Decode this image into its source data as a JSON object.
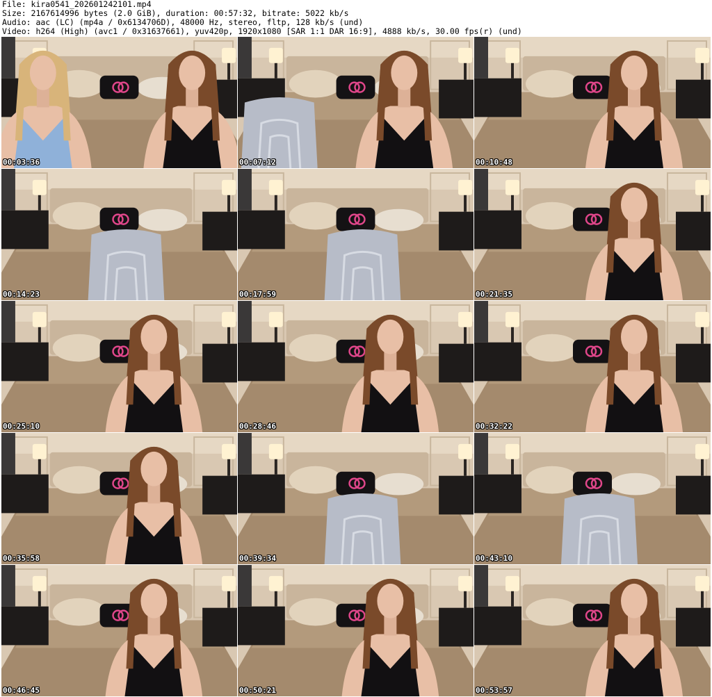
{
  "header": {
    "file_line": "File: kira0541_202601242101.mp4",
    "size_line": "Size: 2167614996 bytes (2.0 GiB), duration: 00:57:32, bitrate: 5022 kb/s",
    "audio_line": "Audio: aac (LC) (mp4a / 0x6134706D), 48000 Hz, stereo, fltp, 128 kb/s (und)",
    "video_line": "Video: h264 (High) (avc1 / 0x31637661), yuv420p, 1920x1080 [SAR 1:1 DAR 16:9], 4888 kb/s, 30.00 fps(r) (und)"
  },
  "colors": {
    "wall": "#d9c8b2",
    "headboard": "#c9b59c",
    "bed": "#a48a6d",
    "nightstand": "#1e1b1a",
    "lamp": "#fff2d2",
    "pillow_dark": "#141214",
    "pillow_logo": "#e0468a",
    "chair": "#b7bcc8",
    "hair_brown": "#7a4a2a",
    "hair_blonde": "#d8b47a",
    "skin": "#e8bfa6",
    "top_black": "#121012",
    "timestamp": "#ffffff"
  },
  "thumbnails": [
    {
      "timestamp": "00:03:36",
      "scene": "two-people"
    },
    {
      "timestamp": "00:07:12",
      "scene": "person-chair"
    },
    {
      "timestamp": "00:10:48",
      "scene": "person-right"
    },
    {
      "timestamp": "00:14:23",
      "scene": "empty-chair"
    },
    {
      "timestamp": "00:17:59",
      "scene": "empty-chair"
    },
    {
      "timestamp": "00:21:35",
      "scene": "person-right"
    },
    {
      "timestamp": "00:25:10",
      "scene": "person-center"
    },
    {
      "timestamp": "00:28:46",
      "scene": "person-center"
    },
    {
      "timestamp": "00:32:22",
      "scene": "person-right"
    },
    {
      "timestamp": "00:35:58",
      "scene": "person-center"
    },
    {
      "timestamp": "00:39:34",
      "scene": "empty-chair"
    },
    {
      "timestamp": "00:43:10",
      "scene": "empty-chair"
    },
    {
      "timestamp": "00:46:45",
      "scene": "person-center"
    },
    {
      "timestamp": "00:50:21",
      "scene": "person-center"
    },
    {
      "timestamp": "00:53:57",
      "scene": "person-right"
    }
  ]
}
